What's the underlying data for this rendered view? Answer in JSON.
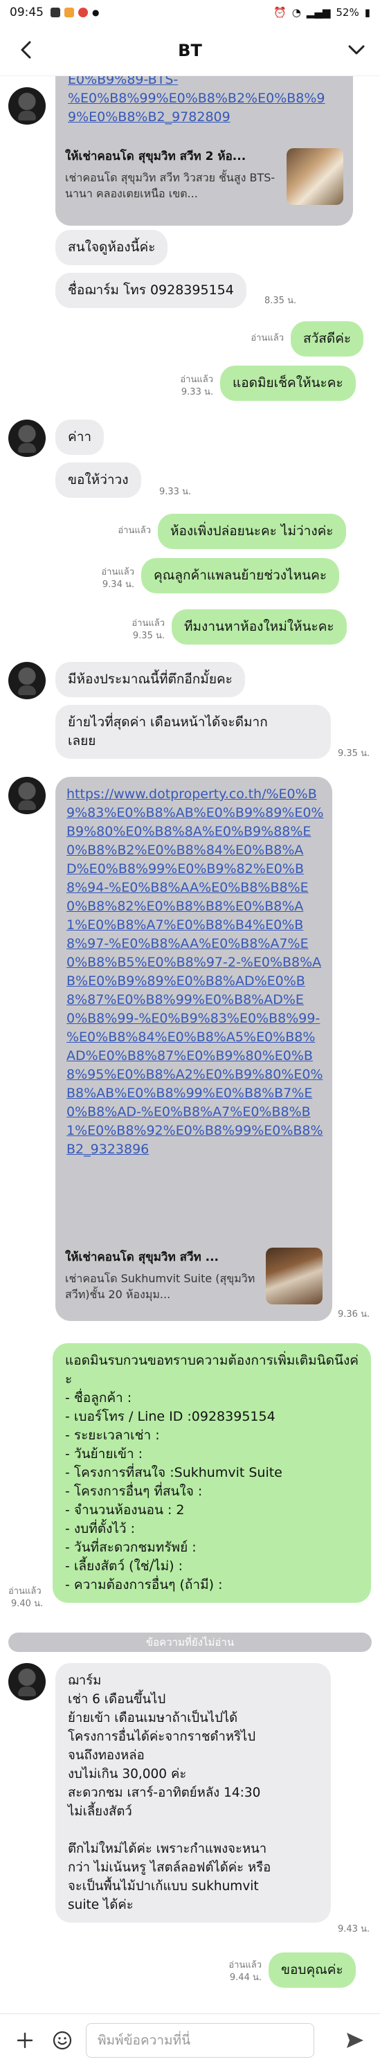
{
  "status": {
    "time": "09:45",
    "battery": "52%"
  },
  "header": {
    "title": "BT"
  },
  "messages": {
    "m1_url_tail": "E0%B9%89-BTS-\n%E0%B8%99%E0%B8%B2%E0%B8%99%E0%B8%B2_9782809",
    "m1_card_title": "ให้เช่าคอนโด สุขุมวิท สวีท 2 ห้อ...",
    "m1_card_desc": "เช่าคอนโด สุขุมวิท สวีท วิวสวย ชั้นสูง BTS-นานา คลองเตยเหนือ เขต...",
    "m2": "สนใจดูห้องนี้ค่ะ",
    "m3": "ชื่อฌาร์ม โทร 0928395154",
    "m3_time": "8.35 น.",
    "o1": "สวัสดีค่ะ",
    "o1_read": "อ่านแล้ว",
    "o2": "แอดมิยเช็คให้นะคะ",
    "o2_read": "อ่านแล้ว",
    "o2_time": "9.33 น.",
    "m4": "ค่าา",
    "m5": "ขอให้ว่าวง",
    "m5_time": "9.33 น.",
    "o3": "ห้องเพิ่งปล่อยนะคะ ไม่ว่างค่ะ",
    "o3_read": "อ่านแล้ว",
    "o4": "คุณลูกค้าแพลนย้ายช่วงไหนคะ",
    "o4_read": "อ่านแล้ว",
    "o4_time": "9.34 น.",
    "o5": "ทีมงานหาห้องใหม่ให้นะคะ",
    "o5_read": "อ่านแล้ว",
    "o5_time": "9.35 น.",
    "m6": "มีห้องประมาณนี้ที่ตึกอีกมั้ยคะ",
    "m7": "ย้ายไวที่สุดค่า เดือนหน้าได้จะดีมาก\nเลยย",
    "m7_time": "9.35 น.",
    "m8_url": "https://www.dotproperty.co.th/%E0%B9%83%E0%B8%AB%E0%B9%89%E0%B9%80%E0%B8%8A%E0%B9%88%E0%B8%B2%E0%B8%84%E0%B8%AD%E0%B8%99%E0%B9%82%E0%B8%94-%E0%B8%AA%E0%B8%B8%E0%B8%82%E0%B8%B8%E0%B8%A1%E0%B8%A7%E0%B8%B4%E0%B8%97-%E0%B8%AA%E0%B8%A7%E0%B8%B5%E0%B8%97-2-%E0%B8%AB%E0%B9%89%E0%B8%AD%E0%B8%87%E0%B8%99%E0%B8%AD%E0%B8%99-%E0%B9%83%E0%B8%99-%E0%B8%84%E0%B8%A5%E0%B8%AD%E0%B8%87%E0%B9%80%E0%B8%95%E0%B8%A2%E0%B9%80%E0%B8%AB%E0%B8%99%E0%B8%B7%E0%B8%AD-%E0%B8%A7%E0%B8%B1%E0%B8%92%E0%B8%99%E0%B8%B2_9323896",
    "m8_card_title": "ให้เช่าคอนโด สุขุมวิท สวีท ...",
    "m8_card_desc": "เช่าคอนโด Sukhumvit Suite (สุขุมวิท สวีท)ชั้น 20 ห้องมุม...",
    "m8_time": "9.36 น.",
    "o6": "แอดมินรบกวนขอทราบความต้องการเพิ่มเติมนิดนึงค่ะ\n- ชื่อลูกค้า :\n- เบอร์โทร / Line ID :0928395154\n- ระยะเวลาเช่า :\n- วันย้ายเข้า :\n- โครงการที่สนใจ :Sukhumvit Suite\n- โครงการอื่นๆ ที่สนใจ :\n- จำนวนห้องนอน : 2\n- งบที่ตั้งไว้ :\n- วันที่สะดวกชมทรัพย์ :\n- เลี้ยงสัตว์ (ใช่/ไม่) :\n- ความต้องการอื่นๆ (ถ้ามี) :",
    "o6_read": "อ่านแล้ว",
    "o6_time": "9.40 น.",
    "unread_label": "ข้อความที่ยังไม่อ่าน",
    "m9": "ฌาร์ม\nเช่า 6 เดือนขึ้นไป\nย้ายเข้า เดือนเมษาถ้าเป็นไปได้\nโครงการอื่นได้ค่ะจากราชดำหริไป\nจนถึงทองหล่อ\nงบไม่เกิน 30,000 ค่ะ\nสะดวกชม เสาร์-อาทิตย์หลัง 14:30\nไม่เลี้ยงสัตว์\n\nตึกไม่ใหม่ได้ค่ะ เพราะกำแพงจะหนา\nกว่า ไม่เน้นหรู ไสตล์ลอฟต์ได้ค่ะ หรือ\nจะเป็นพื้นไม้ปาเก้แบบ sukhumvit\nsuite ได้ค่ะ",
    "m9_time": "9.43 น.",
    "o7": "ขอบคุณค่ะ",
    "o7_read": "อ่านแล้ว",
    "o7_time": "9.44 น."
  },
  "composer": {
    "placeholder": "พิมพ์ข้อความที่นี่"
  },
  "colors": {
    "incoming": "#ececef",
    "outgoing": "#b8eca6",
    "link": "#3557b8"
  }
}
